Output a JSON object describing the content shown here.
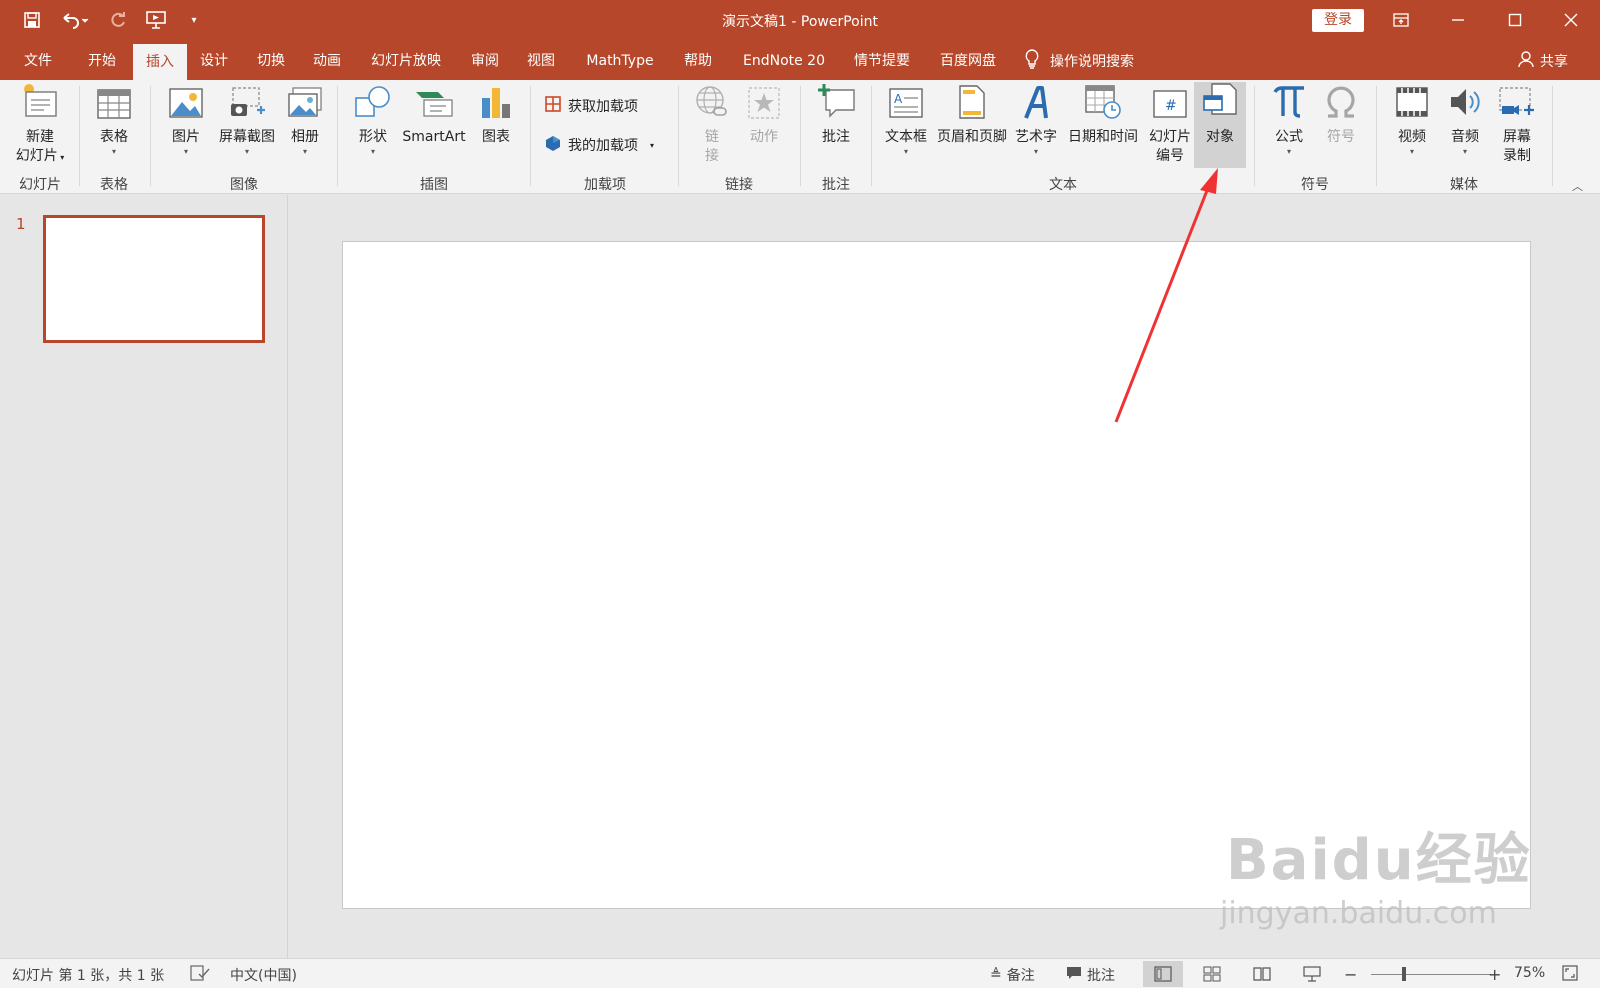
{
  "window": {
    "title": "演示文稿1  -  PowerPoint",
    "login_label": "登录",
    "accent_color": "#b7472a"
  },
  "qat": {
    "icons": [
      "save-icon",
      "undo-icon",
      "redo-icon",
      "start-slideshow-icon",
      "customize-qat-icon"
    ]
  },
  "tabs": [
    {
      "label": "文件"
    },
    {
      "label": "开始"
    },
    {
      "label": "插入"
    },
    {
      "label": "设计"
    },
    {
      "label": "切换"
    },
    {
      "label": "动画"
    },
    {
      "label": "幻灯片放映"
    },
    {
      "label": "审阅"
    },
    {
      "label": "视图"
    },
    {
      "label": "MathType"
    },
    {
      "label": "帮助"
    },
    {
      "label": "EndNote 20"
    },
    {
      "label": "情节提要"
    },
    {
      "label": "百度网盘"
    }
  ],
  "active_tab": "插入",
  "tell_me": "操作说明搜索",
  "share_label": "共享",
  "ribbon": {
    "slides": {
      "new_slide_line1": "新建",
      "new_slide_line2": "幻灯片",
      "group": "幻灯片"
    },
    "tables": {
      "table": "表格",
      "group": "表格"
    },
    "images": {
      "picture": "图片",
      "screenshot": "屏幕截图",
      "album": "相册",
      "group": "图像"
    },
    "illustrations": {
      "shapes": "形状",
      "smartart": "SmartArt",
      "chart": "图表",
      "group": "插图"
    },
    "addins": {
      "get": "获取加载项",
      "mine": "我的加载项",
      "group": "加载项"
    },
    "links": {
      "link_line1": "链",
      "link_line2": "接",
      "action": "动作",
      "group": "链接"
    },
    "comments": {
      "comment": "批注",
      "group": "批注"
    },
    "text": {
      "textbox": "文本框",
      "header_footer": "页眉和页脚",
      "wordart": "艺术字",
      "datetime": "日期和时间",
      "slide_number_line1": "幻灯片",
      "slide_number_line2": "编号",
      "object": "对象",
      "group": "文本"
    },
    "symbols": {
      "equation": "公式",
      "symbol": "符号",
      "group": "符号"
    },
    "media": {
      "video": "视频",
      "audio": "音频",
      "screen_rec_line1": "屏幕",
      "screen_rec_line2": "录制",
      "group": "媒体"
    }
  },
  "thumbnails": [
    {
      "number": "1"
    }
  ],
  "status": {
    "slide_info": "幻灯片 第 1 张，共 1 张",
    "language": "中文(中国)",
    "notes": "备注",
    "comments": "批注",
    "zoom": "75%"
  },
  "watermark": {
    "main": "Baidu经验",
    "sub": "jingyan.baidu.com"
  }
}
